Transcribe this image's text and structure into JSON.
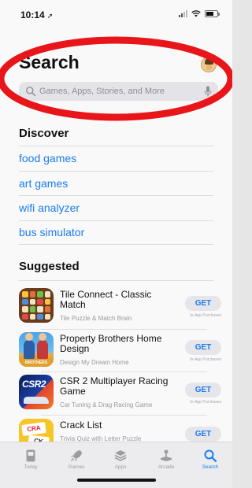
{
  "status_bar": {
    "time": "10:14",
    "location_arrow": "➚"
  },
  "header": {
    "title": "Search",
    "search_placeholder": "Games, Apps, Stories, and More"
  },
  "discover": {
    "title": "Discover",
    "items": [
      "food games",
      "art games",
      "wifi analyzer",
      "bus simulator"
    ]
  },
  "suggested": {
    "title": "Suggested",
    "apps": [
      {
        "name": "Tile Connect - Classic Match",
        "subtitle": "Tile Puzzle & Match Brain",
        "button": "GET",
        "note": "In-App Purchases",
        "icon": "tile-connect-icon"
      },
      {
        "name": "Property Brothers Home Design",
        "subtitle": "Design My Dream Home",
        "button": "GET",
        "note": "In-App Purchases",
        "icon": "property-brothers-icon",
        "icon_text": "BROTHERS"
      },
      {
        "name": "CSR 2 Multiplayer Racing Game",
        "subtitle": "Car Tuning & Drag Racing Game",
        "button": "GET",
        "note": "In-App Purchases",
        "icon": "csr2-icon",
        "icon_text": "CSR2"
      },
      {
        "name": "Crack List",
        "subtitle": "Trivia Quiz with Letter Puzzle",
        "button": "GET",
        "note": "",
        "icon": "crack-list-icon",
        "icon_text_1": "CRA",
        "icon_text_2": "CK"
      }
    ]
  },
  "tabbar": {
    "tabs": [
      {
        "label": "Today",
        "icon": "today-icon"
      },
      {
        "label": "Games",
        "icon": "rocket-icon"
      },
      {
        "label": "Apps",
        "icon": "apps-stack-icon"
      },
      {
        "label": "Arcade",
        "icon": "joystick-icon"
      },
      {
        "label": "Search",
        "icon": "search-icon",
        "active": true
      }
    ]
  },
  "colors": {
    "accent": "#1a7cf0",
    "annotation": "#e8161b",
    "background": "#f9f9f9"
  }
}
